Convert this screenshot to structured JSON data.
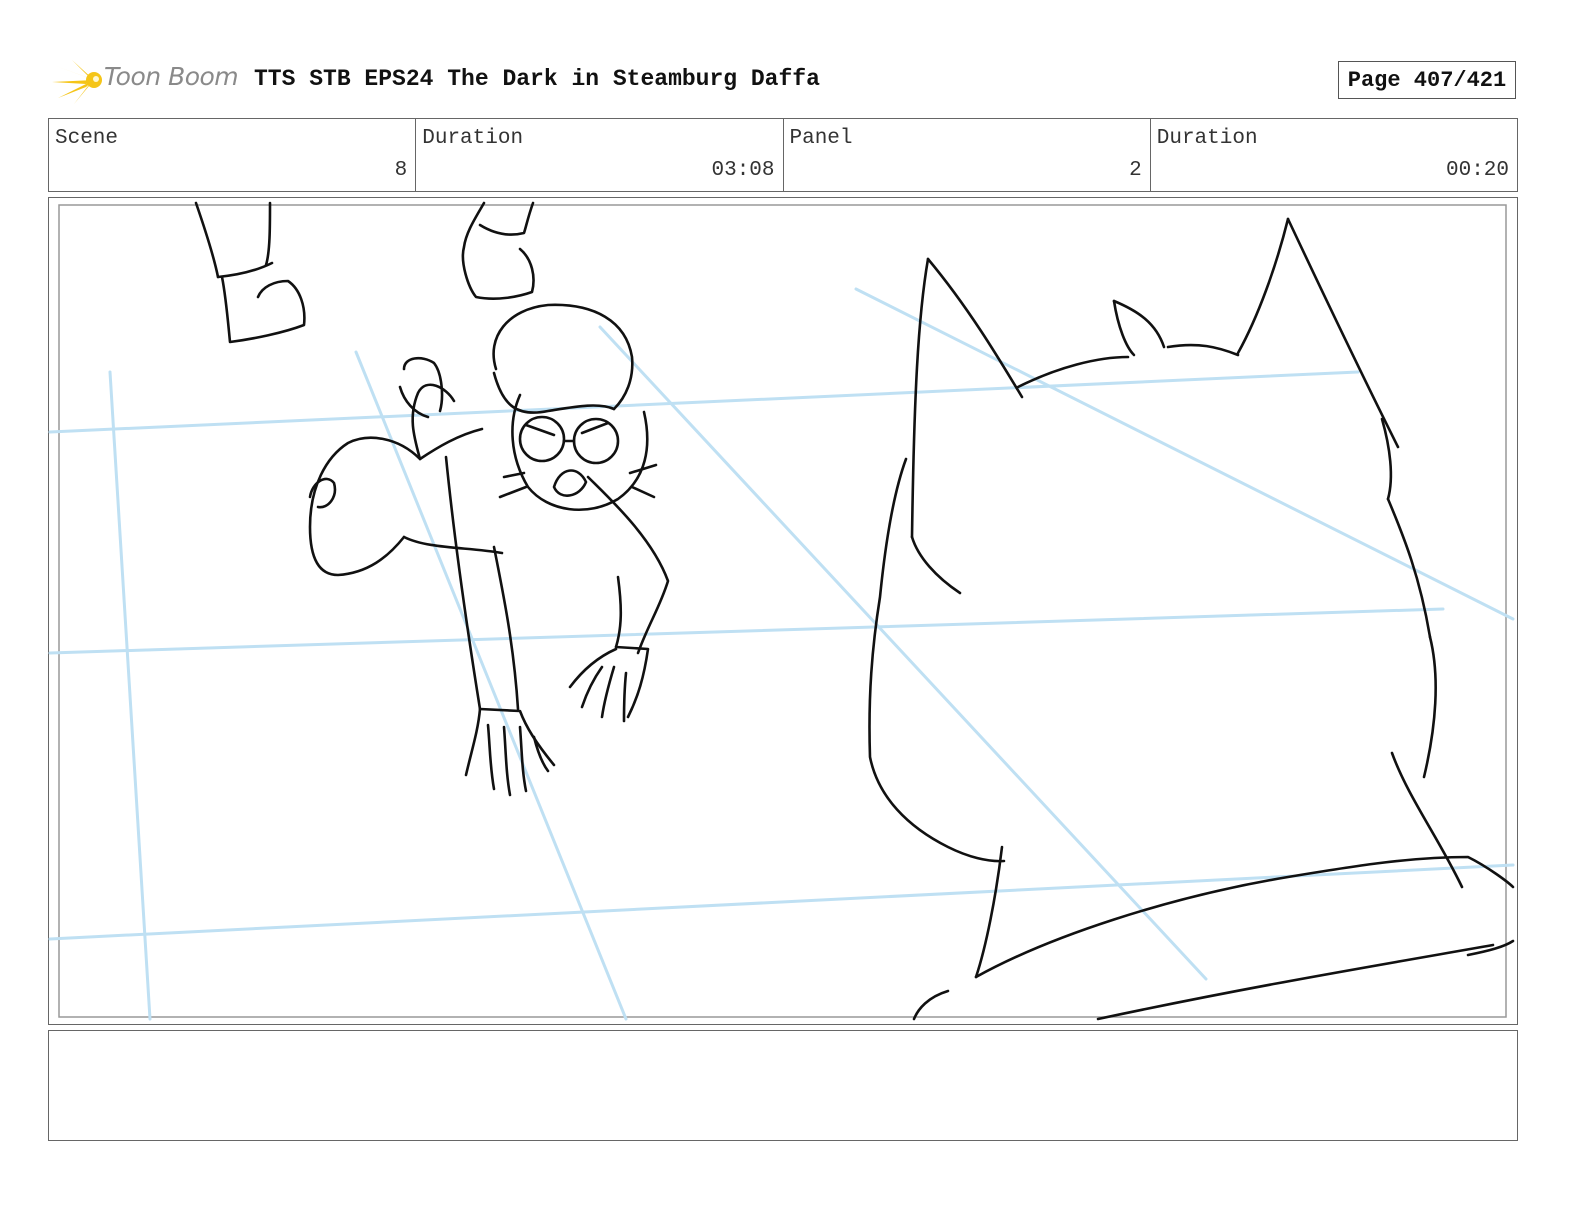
{
  "header": {
    "logo_text": "Toon Boom",
    "title": "TTS STB EPS24 The Dark in Steamburg Daffa",
    "page": "Page 407/421"
  },
  "info": [
    {
      "label": "Scene",
      "value": "8"
    },
    {
      "label": "Duration",
      "value": "03:08"
    },
    {
      "label": "Panel",
      "value": "2"
    },
    {
      "label": "Duration",
      "value": "00:20"
    }
  ],
  "colors": {
    "logo_accent": "#f5c518",
    "guide_lines": "#bfe0f3",
    "ink": "#111111"
  },
  "icons": {
    "logo": "starburst-icon"
  },
  "notes": ""
}
